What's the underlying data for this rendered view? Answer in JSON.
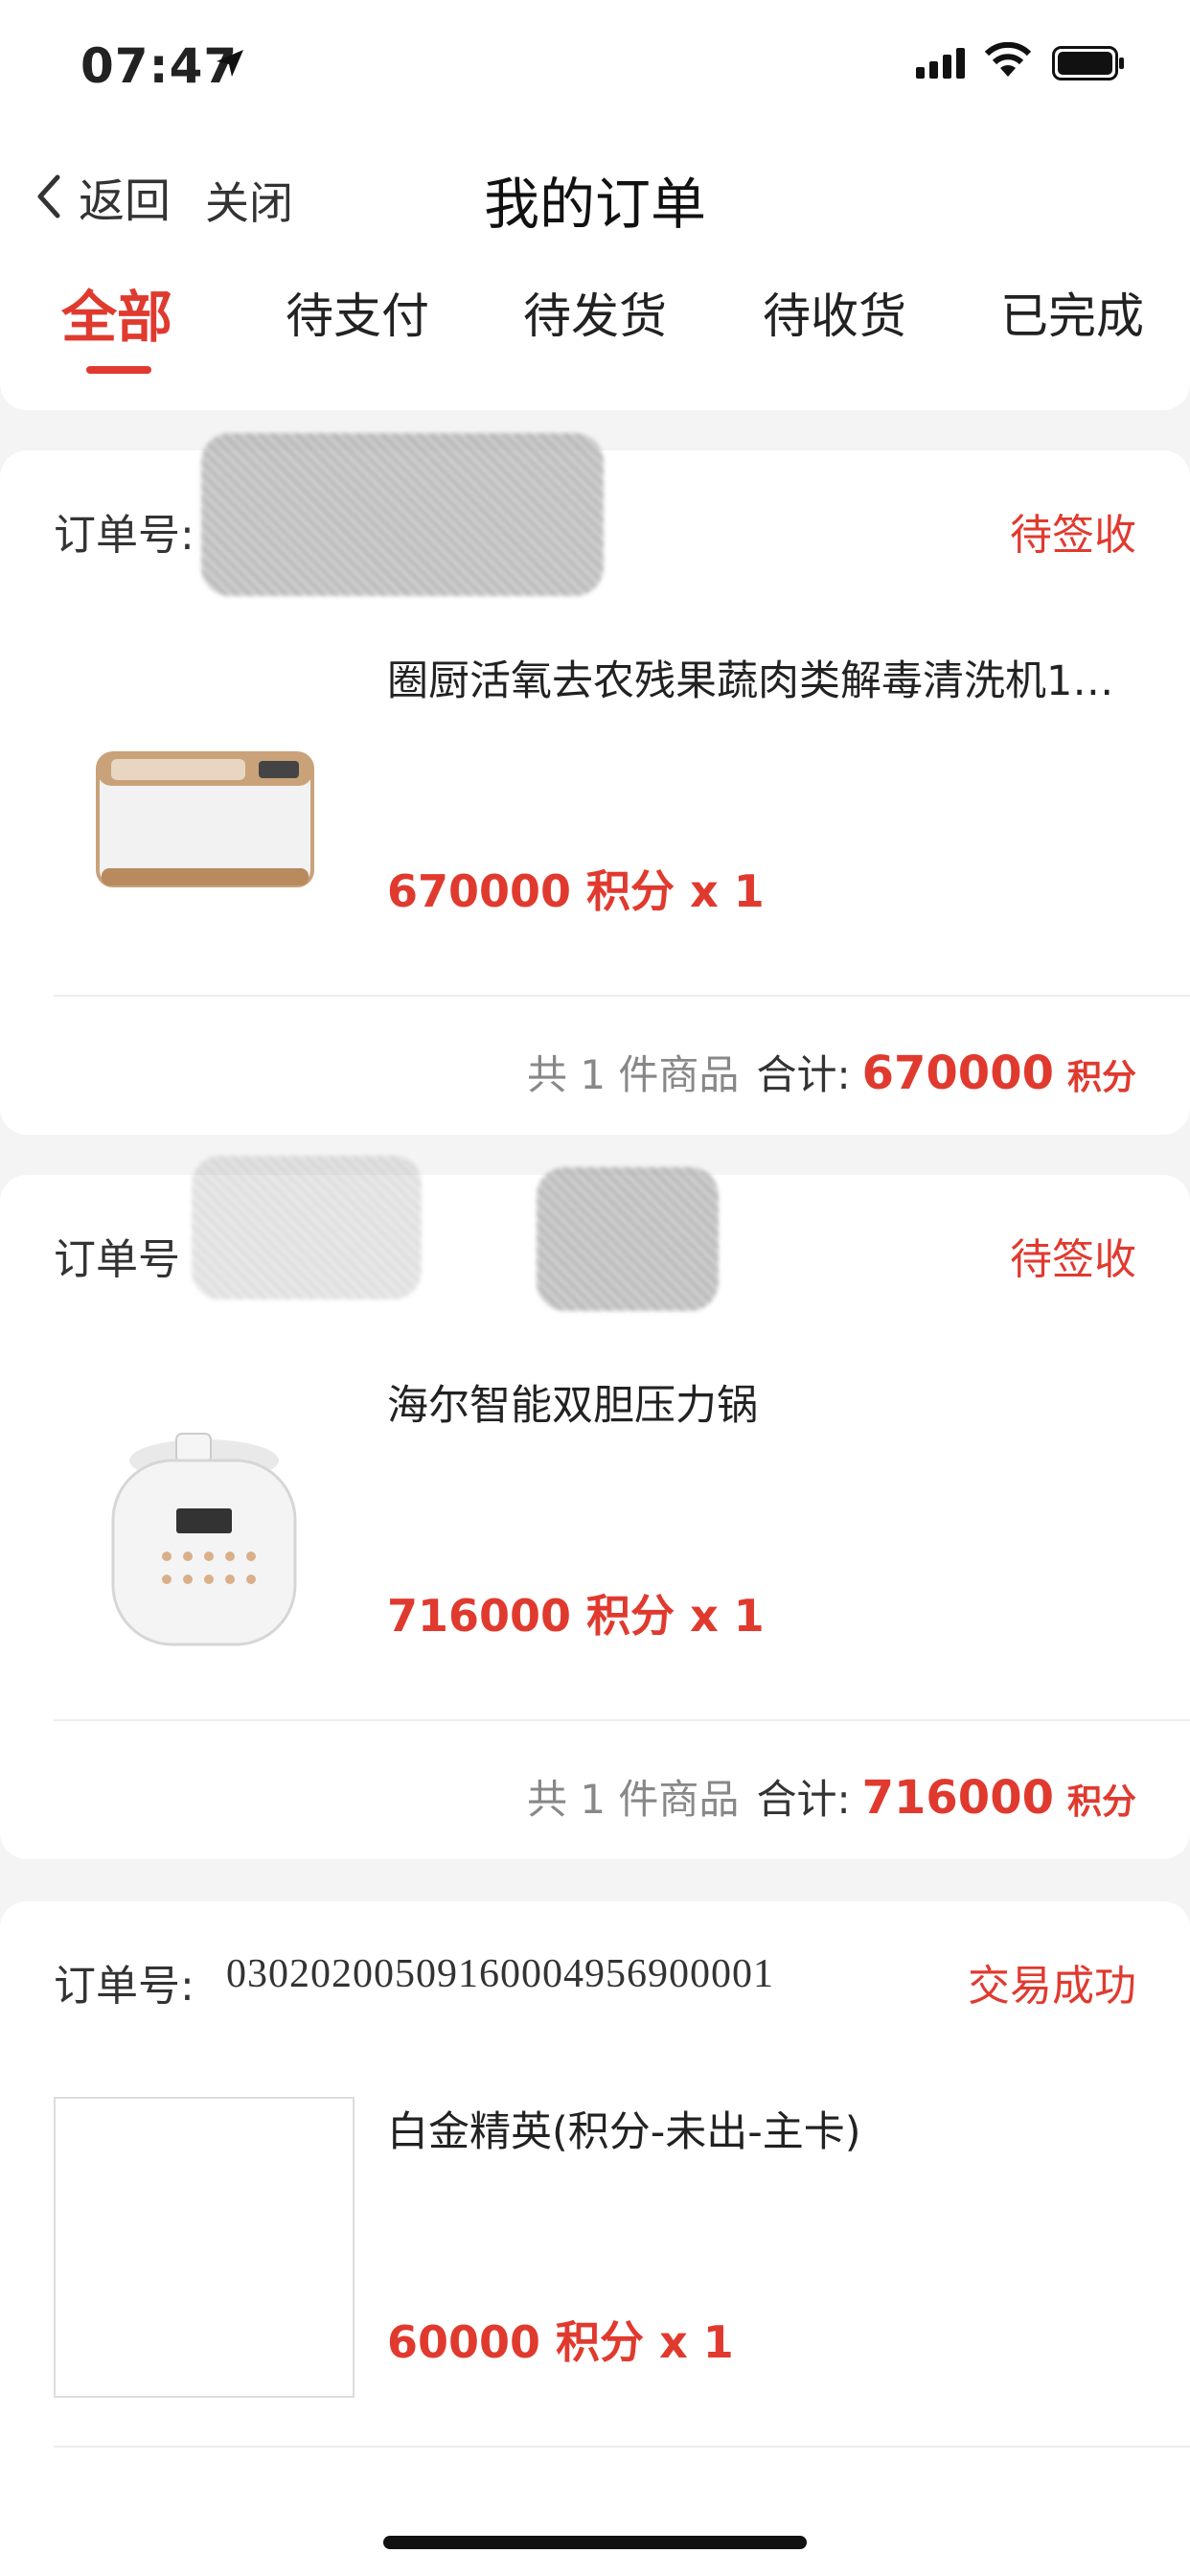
{
  "status_bar": {
    "time": "07:47"
  },
  "header": {
    "back_label": "返回",
    "close_label": "关闭",
    "title": "我的订单"
  },
  "tabs": [
    {
      "label": "全部",
      "active": true
    },
    {
      "label": "待支付"
    },
    {
      "label": "待发货"
    },
    {
      "label": "待收货"
    },
    {
      "label": "已完成"
    }
  ],
  "orders": [
    {
      "order_label": "订单号:",
      "order_no": "",
      "status": "待签收",
      "product_name": "圈厨活氧去农残果蔬肉类解毒清洗机1…",
      "price": "670000 积分 x 1",
      "count_text": "共 1 件商品",
      "total_label": "合计:",
      "total_value": "670000",
      "total_unit": "积分"
    },
    {
      "order_label": "订单号",
      "order_no": "",
      "status": "待签收",
      "product_name": "海尔智能双胆压力锅",
      "price": "716000 积分 x 1",
      "count_text": "共 1 件商品",
      "total_label": "合计:",
      "total_value": "716000",
      "total_unit": "积分"
    },
    {
      "order_label": "订单号:",
      "order_no": "03020200509160004956900001",
      "status": "交易成功",
      "product_name": "白金精英(积分-未出-主卡)",
      "price": "60000 积分 x 1"
    }
  ],
  "colors": {
    "accent": "#e03a2f",
    "background": "#f4f4f4"
  }
}
